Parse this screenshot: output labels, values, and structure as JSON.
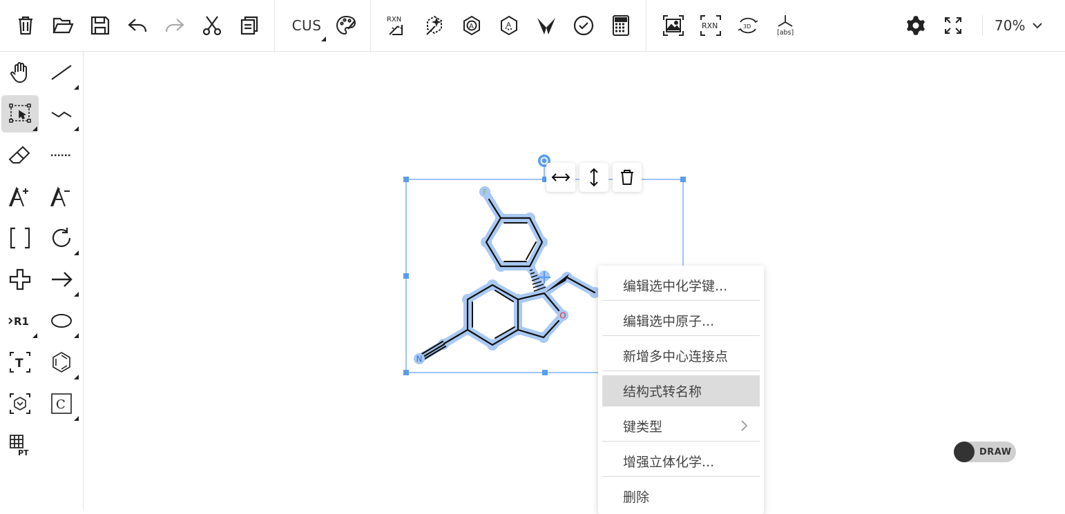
{
  "toolbar": {
    "cus_label": "CUS",
    "rxn_label": "RXN",
    "rxn_box_label": "RXN",
    "d3_label": "3D",
    "abs_label": "[abs]",
    "zoom_value": "70%"
  },
  "left_toolbar": {
    "r1_label": "R1",
    "t_label": "T",
    "c_label": "C",
    "pt_label": "PT"
  },
  "molecule": {
    "atom_labels": {
      "fluorine": "F",
      "oxygen": "O",
      "nitrogen": "N"
    }
  },
  "context_menu": {
    "items": [
      {
        "label": "编辑选中化学键..."
      },
      {
        "label": "编辑选中原子..."
      },
      {
        "label": "新增多中心连接点"
      },
      {
        "label": "结构式转名称"
      },
      {
        "label": "键类型"
      },
      {
        "label": "增强立体化学..."
      },
      {
        "label": "删除"
      }
    ]
  },
  "mode_toggle": {
    "label": "DRAW"
  },
  "colors": {
    "selection": "#5b9dec",
    "atom_highlight": "#a9c9f3",
    "fluorine": "#8ab85a",
    "oxygen": "#d63a3a",
    "nitrogen": "#3e6fd9"
  }
}
